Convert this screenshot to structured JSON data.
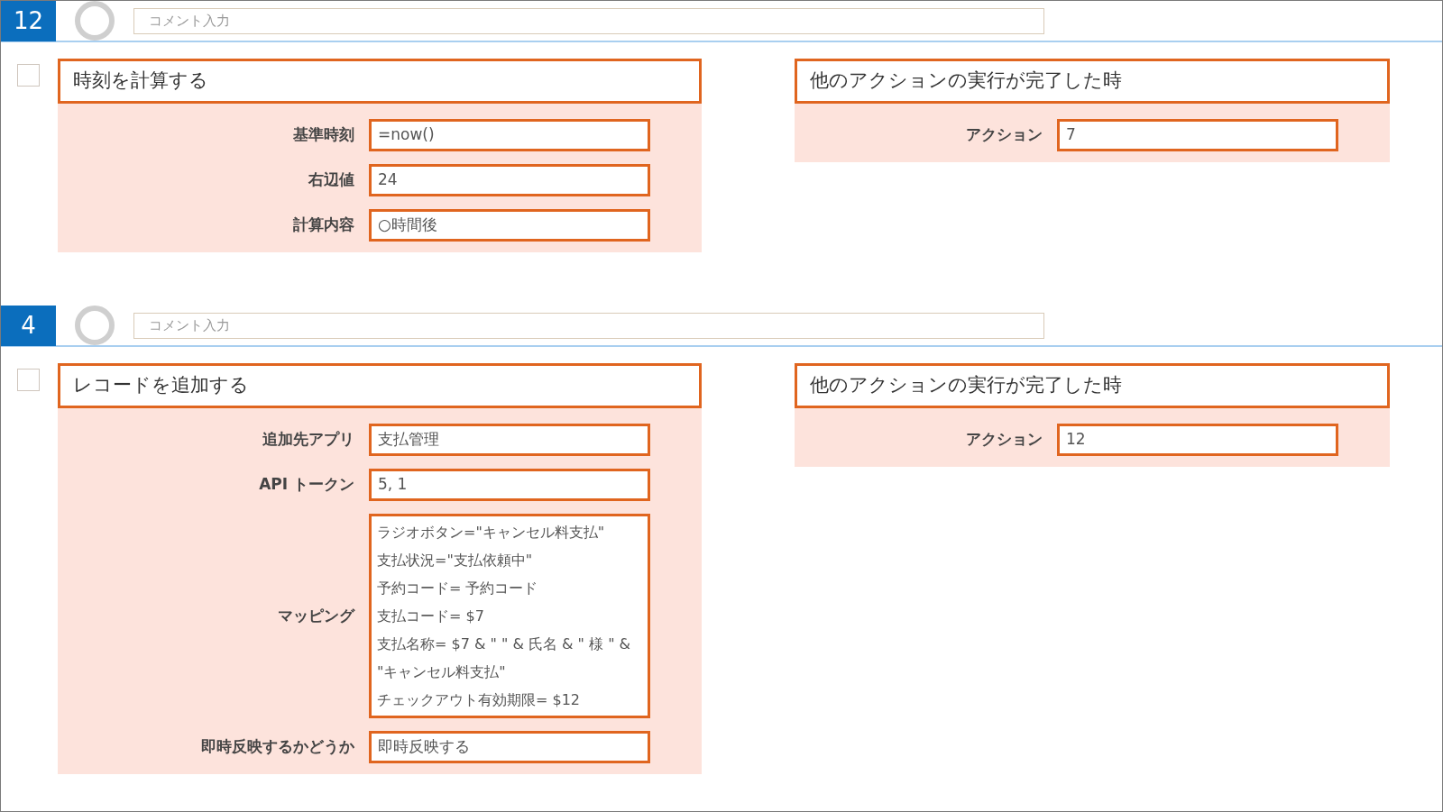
{
  "steps": [
    {
      "number": "12",
      "comment": {
        "placeholder": "コメント入力"
      },
      "checked": false,
      "action": {
        "title": "時刻を計算する",
        "fields": [
          {
            "kind": "text",
            "label": "基準時刻",
            "value": "=now()"
          },
          {
            "kind": "text",
            "label": "右辺値",
            "value": "24"
          },
          {
            "kind": "text",
            "label": "計算内容",
            "value": "○時間後"
          }
        ]
      },
      "trigger": {
        "title": "他のアクションの実行が完了した時",
        "fields": [
          {
            "kind": "text",
            "label": "アクション",
            "value": "7"
          }
        ]
      }
    },
    {
      "number": "4",
      "comment": {
        "placeholder": "コメント入力"
      },
      "checked": false,
      "action": {
        "title": "レコードを追加する",
        "fields": [
          {
            "kind": "text",
            "label": "追加先アプリ",
            "value": "支払管理"
          },
          {
            "kind": "text",
            "label": "API トークン",
            "value": "5, 1"
          },
          {
            "kind": "multiline",
            "label": "マッピング",
            "lines": [
              "ラジオボタン=\"キャンセル料支払\"",
              "支払状況=\"支払依頼中\"",
              "予約コード= 予約コード",
              "支払コード= $7",
              "支払名称= $7 & \" \" & 氏名 & \" 様 \" &",
              "\"キャンセル料支払\"",
              "チェックアウト有効期限= $12"
            ]
          },
          {
            "kind": "text",
            "label": "即時反映するかどうか",
            "value": "即時反映する"
          }
        ]
      },
      "trigger": {
        "title": "他のアクションの実行が完了した時",
        "fields": [
          {
            "kind": "text",
            "label": "アクション",
            "value": "12"
          }
        ]
      }
    }
  ]
}
